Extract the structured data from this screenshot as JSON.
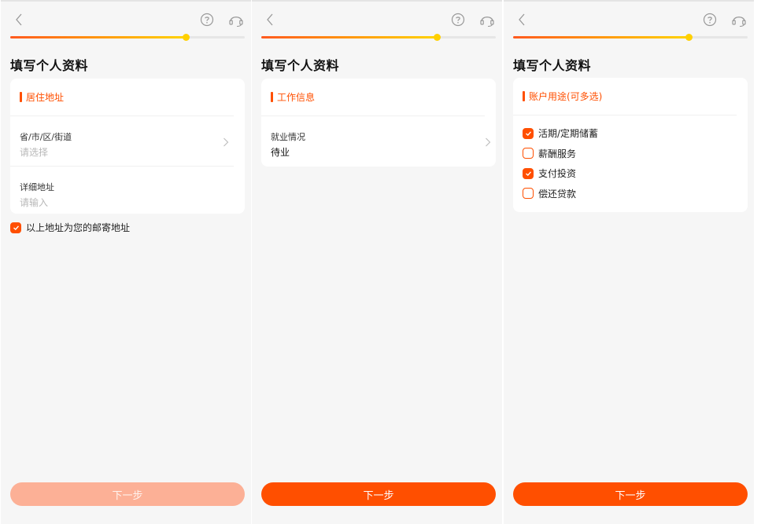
{
  "screens": [
    {
      "page_title": "填写个人资料",
      "progress": 0.75,
      "section_title": "居住地址",
      "fields": [
        {
          "label": "省/市/区/街道",
          "value": "请选择",
          "placeholder": true,
          "has_chevron": true
        },
        {
          "label": "详细地址",
          "value": "请输入",
          "placeholder": true,
          "has_chevron": false
        }
      ],
      "mailing_checkbox": {
        "label": "以上地址为您的邮寄地址",
        "checked": true
      },
      "next_button": {
        "label": "下一步",
        "enabled": false
      }
    },
    {
      "page_title": "填写个人资料",
      "progress": 0.75,
      "section_title": "工作信息",
      "fields": [
        {
          "label": "就业情况",
          "value": "待业",
          "placeholder": false,
          "has_chevron": true
        }
      ],
      "next_button": {
        "label": "下一步",
        "enabled": true
      }
    },
    {
      "page_title": "填写个人资料",
      "progress": 0.75,
      "section_title": "账户用途(可多选)",
      "options": [
        {
          "label": "活期/定期储蓄",
          "checked": true
        },
        {
          "label": "薪酬服务",
          "checked": false
        },
        {
          "label": "支付投资",
          "checked": true
        },
        {
          "label": "偿还贷款",
          "checked": false
        }
      ],
      "next_button": {
        "label": "下一步",
        "enabled": true
      }
    }
  ],
  "icons": {
    "back": "chevron-left-icon",
    "help": "question-circle-icon",
    "service": "headset-icon",
    "chevron": "chevron-right-icon",
    "check": "check-icon"
  },
  "colors": {
    "accent": "#ff4f00",
    "accent_disabled": "#fcb096",
    "progress_start": "#ff5a1f",
    "progress_end": "#ffd400",
    "background": "#f6f6f6",
    "card": "#ffffff"
  }
}
